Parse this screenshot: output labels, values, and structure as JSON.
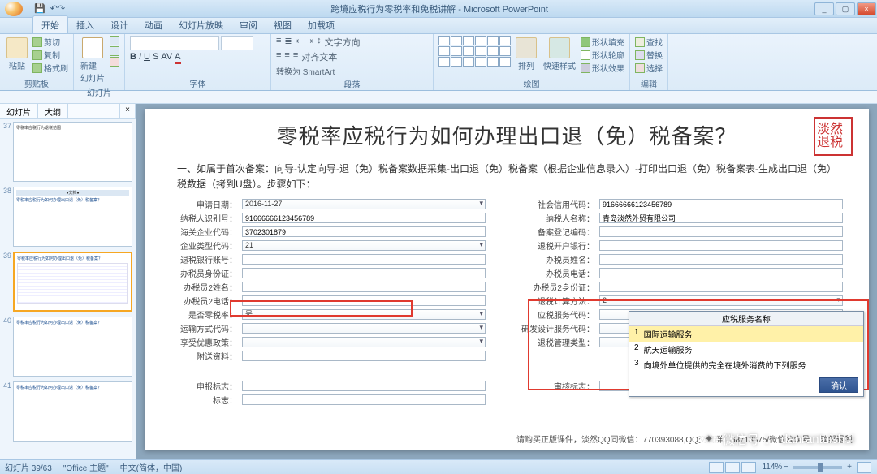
{
  "window": {
    "app_title": "跨境应税行为零税率和免税讲解 - Microsoft PowerPoint",
    "min": "_",
    "max": "▢",
    "close": "×",
    "help": "?"
  },
  "ribbon": {
    "tabs": [
      "开始",
      "插入",
      "设计",
      "动画",
      "幻灯片放映",
      "审阅",
      "视图",
      "加载项"
    ],
    "active": 0,
    "groups": {
      "clipboard": "剪贴板",
      "paste": "粘贴",
      "cut": "剪切",
      "copy": "复制",
      "format": "格式刷",
      "slides": "幻灯片",
      "newslide": "新建\n幻灯片",
      "font": "字体",
      "para": "段落",
      "textdir": "文字方向",
      "align": "对齐文本",
      "smartart": "转换为 SmartArt",
      "draw": "绘图",
      "arrange": "排列",
      "quick": "快速样式",
      "shapefill": "形状填充",
      "shapeline": "形状轮廓",
      "shapefx": "形状效果",
      "edit": "编辑",
      "find": "查找",
      "replace": "替换",
      "select": "选择"
    }
  },
  "pane": {
    "tab1": "幻灯片",
    "tab2": "大纲"
  },
  "thumbs": [
    {
      "n": "37",
      "title": "零税率应税行为退税范围"
    },
    {
      "n": "38",
      "title": "零税率应税行为如何办理出口退（免）税备案？",
      "badge": "●文档●"
    },
    {
      "n": "39",
      "title": "零税率应税行为如何办理出口退（免）税备案？"
    },
    {
      "n": "40",
      "title": "零税率应税行为如何办理出口退（免）税备案？"
    },
    {
      "n": "41",
      "title": "零税率应税行为如何办理出口退（免）税备案？"
    }
  ],
  "slide": {
    "title": "零税率应税行为如何办理出口退（免）税备案？",
    "stamp": "淡然退税",
    "instr": "一、如属于首次备案：向导-认定向导-退（免）税备案数据采集-出口退（免）税备案（根据企业信息录入）-打印出口退（免）税备案表-生成出口退（免）税数据（拷到U盘）。步骤如下：",
    "left_labels": [
      "申请日期：",
      "纳税人识别号：",
      "海关企业代码：",
      "企业类型代码：",
      "退税银行账号：",
      "办税员身份证：",
      "办税员2姓名：",
      "办税员2电话：",
      "是否零税率：",
      "运输方式代码：",
      "享受优惠政策：",
      "附送资料：",
      "申报标志：",
      "标志："
    ],
    "right_labels": [
      "社会信用代码：",
      "纳税人名称：",
      "备案登记编码：",
      "退税开户银行：",
      "办税员姓名：",
      "办税员电话：",
      "办税员2身份证：",
      "退税计算方法：",
      "应税服务代码：",
      "研发设计服务代码：",
      "退税管理类型：",
      "",
      "审核标志：",
      ""
    ],
    "values": {
      "date": "2016-11-27",
      "taxid": "91666666123456789",
      "customs": "3702301879",
      "enttype": "21",
      "zerotax": "是",
      "social": "91666666123456789",
      "name": "青岛淡然外贸有限公司",
      "calc": "2"
    },
    "dropdown": {
      "header": "应税服务名称",
      "rows": [
        {
          "n": "1",
          "t": "国际运输服务"
        },
        {
          "n": "2",
          "t": "航天运输服务"
        },
        {
          "n": "3",
          "t": "向境外单位提供的完全在境外消费的下列服务"
        }
      ],
      "ok": "确认"
    },
    "footer": "请购买正版课件，淡然QQ同微信：770393088,QQ交流群：68713575/微信公众号 ：淡然退税"
  },
  "watermark": {
    "label": "微信号",
    "id": "danrantuishui"
  },
  "status": {
    "pos": "幻灯片 39/63",
    "theme": "\"Office 主题\"",
    "lang": "中文(简体，中国)",
    "zoom": "114%"
  }
}
